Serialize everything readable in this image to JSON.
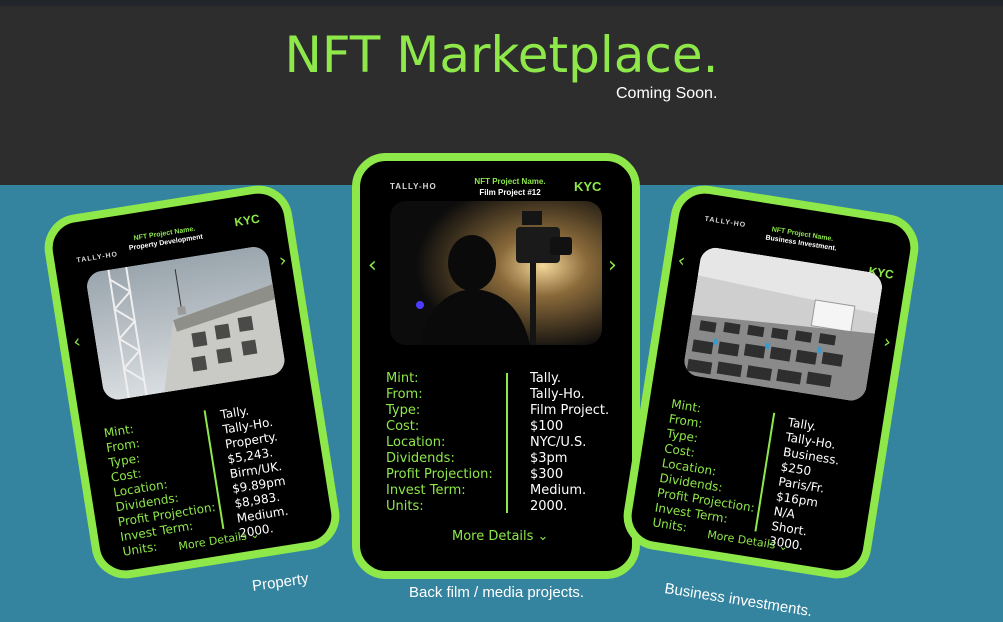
{
  "header": {
    "title": "NFT Marketplace.",
    "subtitle": "Coming Soon."
  },
  "colors": {
    "accent": "#8ee84a",
    "header_bg": "#2d2d2d",
    "section_bg": "#34849f",
    "card_bg": "#000000"
  },
  "field_labels": [
    "Mint:",
    "From:",
    "Type:",
    "Cost:",
    "Location:",
    "Dividends:",
    "Profit Projection:",
    "Invest Term:",
    "Units:"
  ],
  "cards": {
    "left": {
      "brand": "TALLY-HO",
      "project_label": "NFT Project Name.",
      "project_name": "Property Development",
      "kyc": "KYC",
      "values": [
        "Tally.",
        "Tally-Ho.",
        "Property.",
        "$5,243.",
        "Birm/UK.",
        "$9.89pm",
        "$8,983.",
        "Medium.",
        "2000."
      ],
      "more": "More Details ⌄",
      "caption": "Property"
    },
    "center": {
      "brand": "TALLY-HO",
      "project_label": "NFT Project Name.",
      "project_name": "Film Project #12",
      "kyc": "KYC",
      "values": [
        "Tally.",
        "Tally-Ho.",
        "Film Project.",
        "$100",
        "NYC/U.S.",
        "$3pm",
        "$300",
        "Medium.",
        "2000."
      ],
      "more": "More Details ⌄",
      "caption": "Back film / media projects."
    },
    "right": {
      "brand": "TALLY-HO",
      "project_label": "NFT Project Name.",
      "project_name": "Business Investment.",
      "kyc": "KYC",
      "values": [
        "Tally.",
        "Tally-Ho.",
        "Business.",
        "$250",
        "Paris/Fr.",
        "$16pm",
        "N/A",
        "Short.",
        "3000."
      ],
      "more": "More Details ⌄",
      "caption": "Business investments."
    }
  },
  "icons": {
    "prev": "chevron-left-icon",
    "next": "chevron-right-icon"
  }
}
